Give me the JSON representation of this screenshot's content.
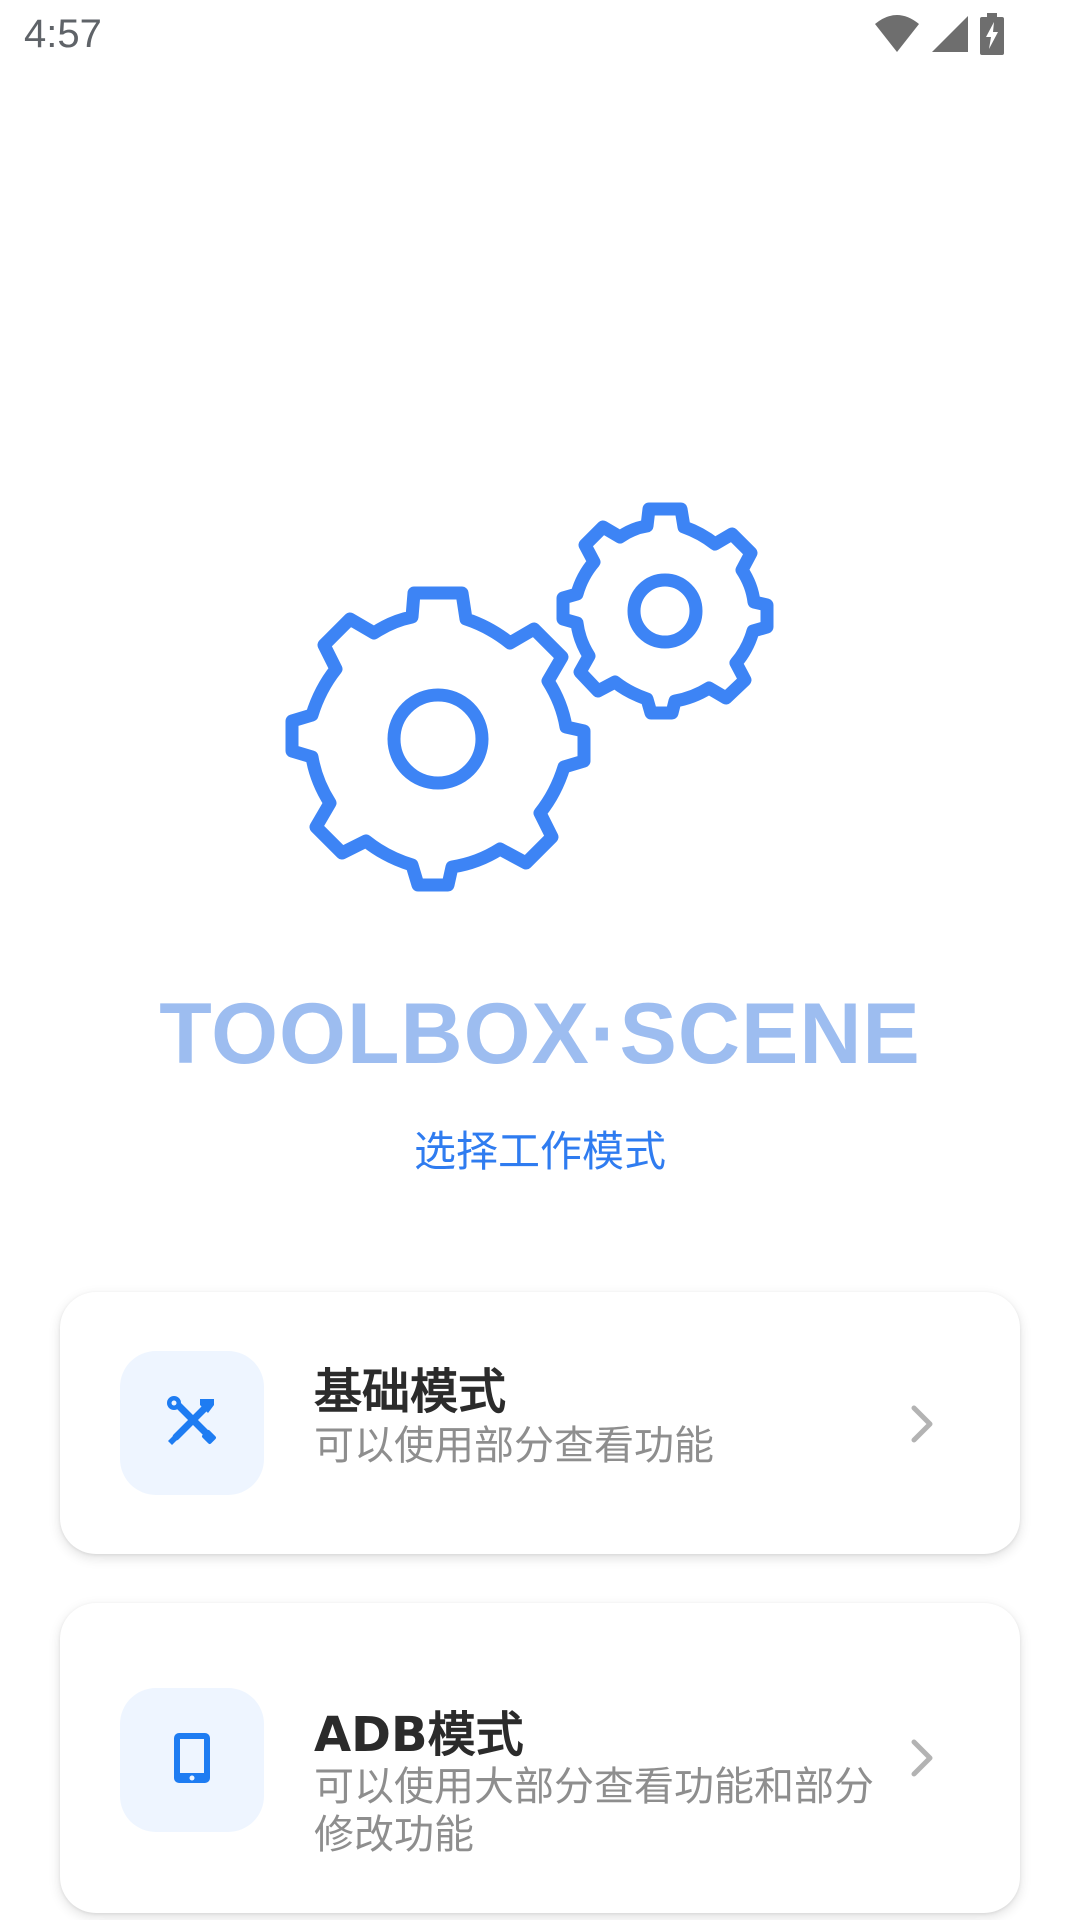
{
  "status_bar": {
    "time": "4:57",
    "icons": [
      "wifi-icon",
      "signal-icon",
      "battery-charging-icon"
    ]
  },
  "hero": {
    "icon": "gears-icon",
    "accent_color": "#3d84f5"
  },
  "app_name": "TOOLBOX·SCENE",
  "subtitle": "选择工作模式",
  "modes": [
    {
      "icon": "tools-icon",
      "title": "基础模式",
      "description": "可以使用部分查看功能"
    },
    {
      "icon": "tablet-icon",
      "title": "ADB模式",
      "description": "可以使用大部分查看功能和部分修改功能"
    }
  ],
  "colors": {
    "accent": "#2f7cf0",
    "app_name": "#9dbdf0",
    "icon_box_bg": "#eef5ff",
    "title_text": "#2b2b2b",
    "desc_text": "#8e8e8e"
  }
}
